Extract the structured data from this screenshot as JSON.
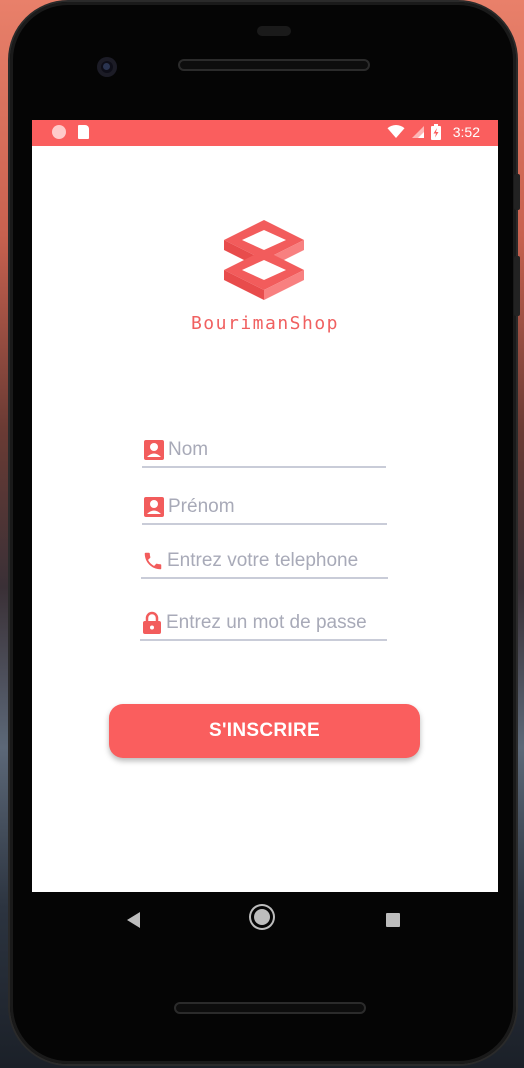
{
  "status_bar": {
    "time": "3:52",
    "icons": [
      "notification-dot-icon",
      "sd-card-icon",
      "wifi-icon",
      "signal-icon",
      "battery-charging-icon"
    ]
  },
  "brand": {
    "name": "BourimanShop",
    "color": "#f06060"
  },
  "form": {
    "fields": [
      {
        "placeholder": "Nom",
        "icon": "person-icon"
      },
      {
        "placeholder": "Prénom",
        "icon": "person-icon"
      },
      {
        "placeholder": "Entrez votre telephone",
        "icon": "phone-icon"
      },
      {
        "placeholder": "Entrez un mot de passe",
        "icon": "lock-icon"
      }
    ],
    "submit_label": "S'INSCRIRE"
  },
  "colors": {
    "accent": "#fa5e5e",
    "placeholder": "#a8aab8",
    "underline": "#c9ccd8"
  },
  "navigation": {
    "buttons": [
      "back-icon",
      "home-icon",
      "recent-apps-icon"
    ]
  }
}
